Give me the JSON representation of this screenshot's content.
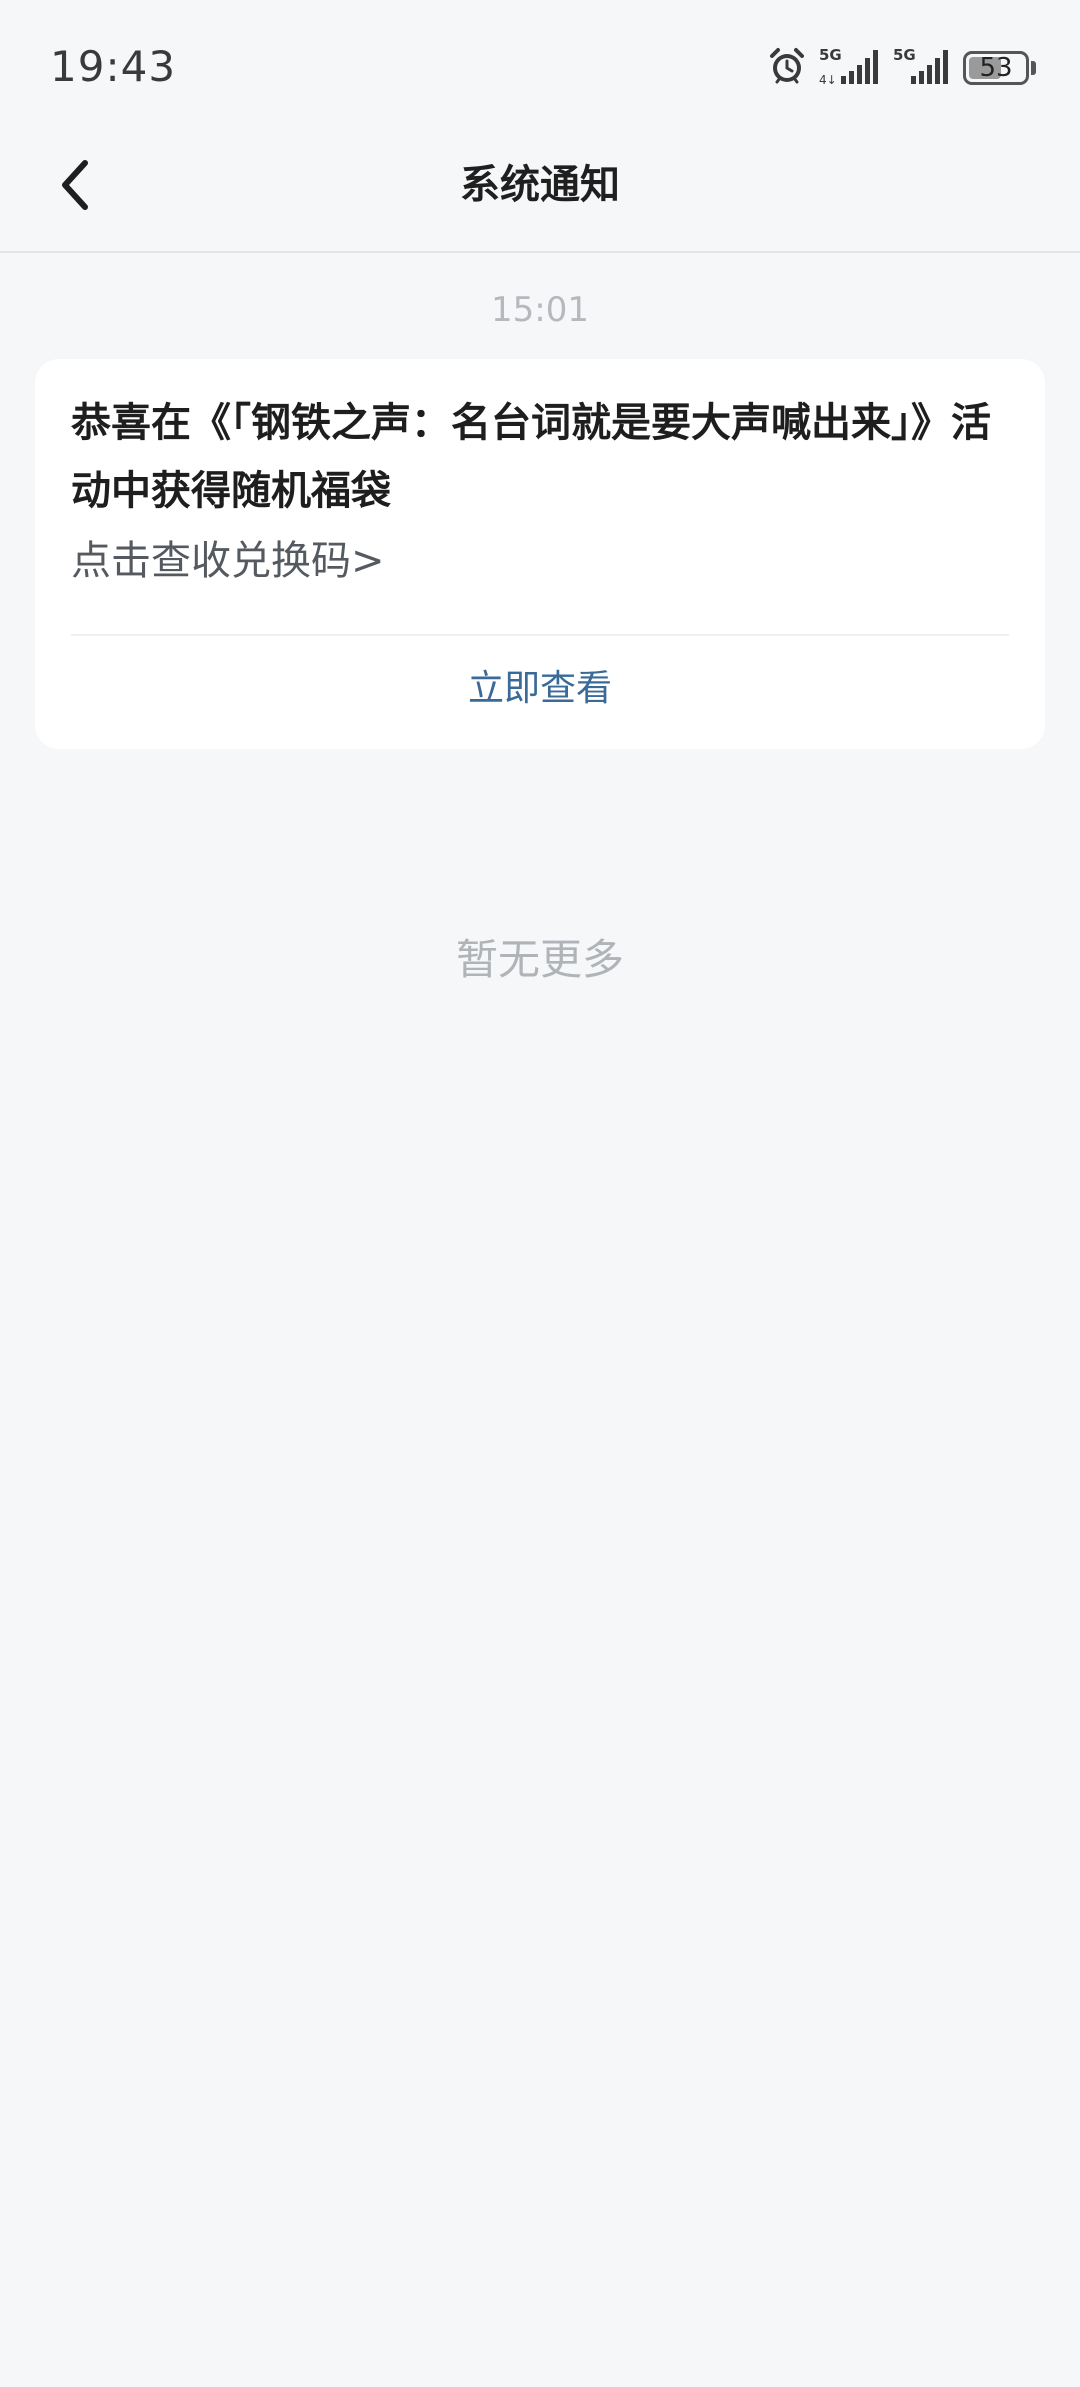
{
  "status_bar": {
    "time": "19:43",
    "battery_level": "53",
    "battery_fraction": 0.53,
    "icons": [
      "alarm-icon",
      "5g-signal-icon",
      "5g-signal-icon",
      "battery-icon"
    ]
  },
  "header": {
    "title": "系统通知",
    "back_icon": "chevron-left-icon"
  },
  "messages": [
    {
      "time": "15:01",
      "title": "恭喜在《「钢铁之声：名台词就是要大声喊出来」》活动中获得随机福袋",
      "subtitle": "点击查收兑换码>",
      "action_label": "立即查看"
    }
  ],
  "footer": {
    "no_more": "暂无更多"
  },
  "colors": {
    "background": "#f6f7f9",
    "card": "#ffffff",
    "link": "#3a6a98",
    "muted": "#b0b3b8"
  }
}
